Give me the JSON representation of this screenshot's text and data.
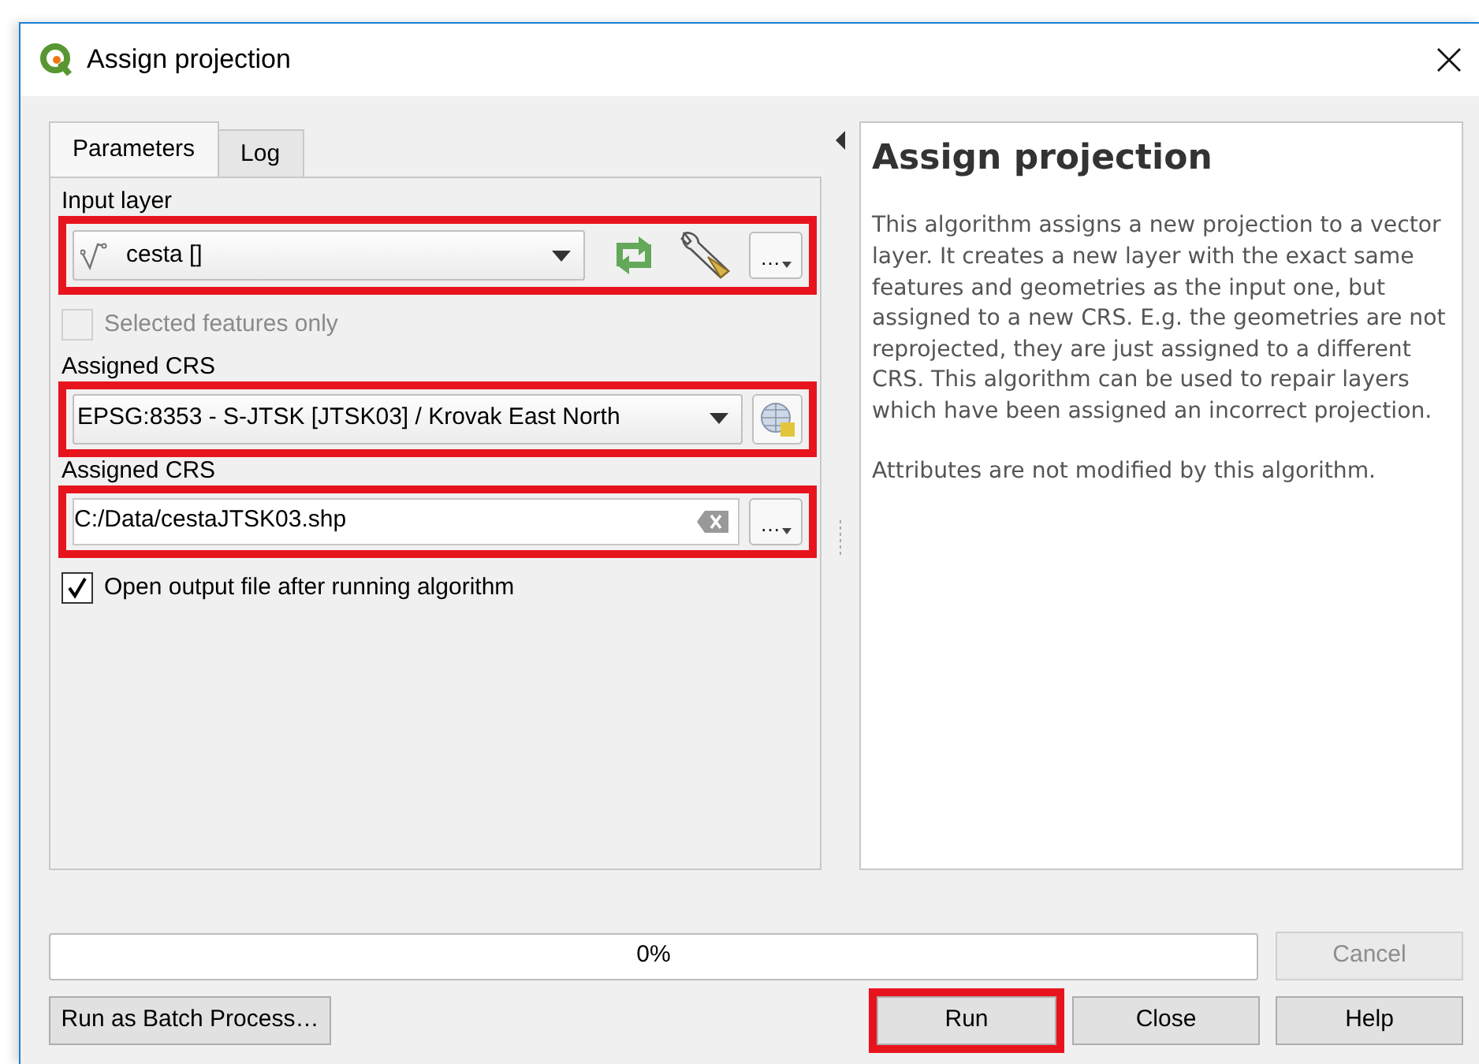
{
  "window": {
    "title": "Assign projection"
  },
  "tabs": [
    {
      "label": "Parameters",
      "selected": true
    },
    {
      "label": "Log",
      "selected": false
    }
  ],
  "parameters": [
    {
      "kind": "layer_select",
      "label": "Input layer",
      "value": "cesta []",
      "highlighted": true,
      "options_button": "…"
    },
    {
      "kind": "checkbox",
      "label": "Selected features only",
      "checked": false,
      "disabled": true
    },
    {
      "kind": "crs_select",
      "label": "Assigned CRS",
      "value": "EPSG:8353 - S-JTSK [JTSK03] / Krovak East North",
      "highlighted": true
    },
    {
      "kind": "file_output",
      "label": "Assigned CRS",
      "value": "C:/Data/cestaJTSK03.shp",
      "highlighted": true,
      "options_button": "…"
    },
    {
      "kind": "checkbox",
      "label": "Open output file after running algorithm",
      "checked": true,
      "disabled": false
    }
  ],
  "help": {
    "title": "Assign projection",
    "paragraphs": [
      "This algorithm assigns a new projection to a vector layer. It creates a new layer with the exact same features and geometries as the input one, but assigned to a new CRS. E.g. the geometries are not reprojected, they are just assigned to a different CRS. This algorithm can be used to repair layers which have been assigned an incorrect projection.",
      "Attributes are not modified by this algorithm."
    ]
  },
  "progress": {
    "level": 0,
    "text": "0%"
  },
  "cancel_button": {
    "label": "Cancel",
    "disabled": true
  },
  "batch_button": {
    "label": "Run as Batch Process…"
  },
  "buttons": [
    {
      "label": "Run",
      "highlighted": true
    },
    {
      "label": "Close",
      "highlighted": false
    },
    {
      "label": "Help",
      "highlighted": false
    }
  ]
}
